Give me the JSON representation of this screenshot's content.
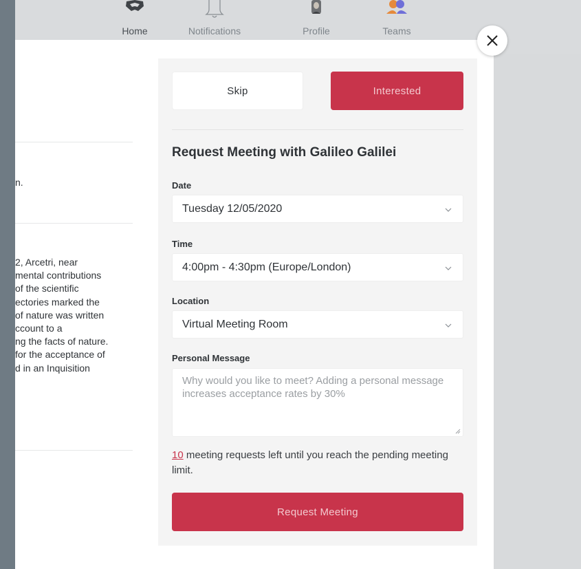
{
  "nav": {
    "items": [
      {
        "label": "Home",
        "icon": "handshake-icon"
      },
      {
        "label": "Notifications",
        "icon": "bell-icon"
      },
      {
        "label": "Profile",
        "icon": "profile-avatar-icon"
      },
      {
        "label": "Teams",
        "icon": "teams-icon"
      }
    ]
  },
  "left_panel": {
    "short_line": "n.",
    "bio_lines": [
      "2, Arcetri, near",
      "mental contributions",
      " of the scientific",
      "ectories marked the",
      "of nature was written",
      "ccount to a",
      "ng the facts of nature.",
      " for the acceptance of",
      "d in an Inquisition"
    ]
  },
  "form": {
    "skip_label": "Skip",
    "interested_label": "Interested",
    "title": "Request Meeting with Galileo Galilei",
    "date_label": "Date",
    "date_value": "Tuesday 12/05/2020",
    "time_label": "Time",
    "time_value": "4:00pm - 4:30pm (Europe/London)",
    "location_label": "Location",
    "location_value": "Virtual Meeting Room",
    "message_label": "Personal Message",
    "message_placeholder": "Why would you like to meet? Adding a personal message increases acceptance rates by 30%",
    "limit_count": "10",
    "limit_text": " meeting requests left until you reach the pending meeting limit.",
    "request_label": "Request Meeting"
  },
  "colors": {
    "accent": "#c8344b",
    "accent_text": "#f3c9cf",
    "panel_bg": "#f4f4f4",
    "backdrop": "#6f7b84"
  }
}
